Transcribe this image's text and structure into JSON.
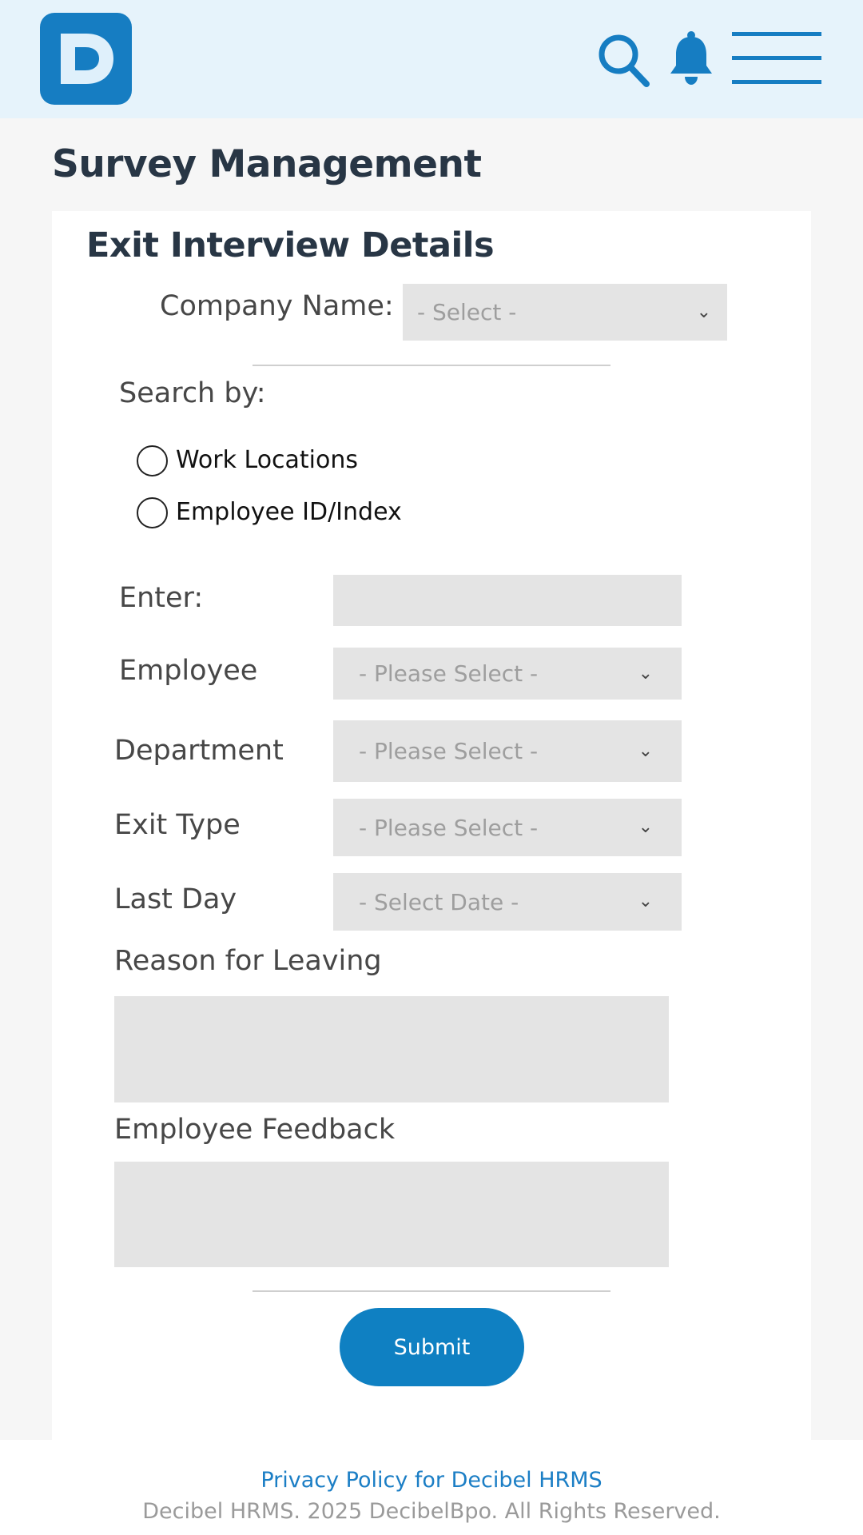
{
  "header": {
    "logo_icon": "decibel-d-logo",
    "search_icon": "search-icon",
    "bell_icon": "bell-icon",
    "menu_icon": "hamburger-menu-icon",
    "accent_color": "#167dc2"
  },
  "page": {
    "title": "Survey Management"
  },
  "card": {
    "title": "Exit Interview Details",
    "company": {
      "label": "Company Name:",
      "value": "- Select -"
    },
    "search_by": {
      "label": "Search by:",
      "options": [
        "Work Locations",
        "Employee ID/Index"
      ]
    },
    "enter": {
      "label": "Enter:",
      "value": ""
    },
    "employee": {
      "label": "Employee",
      "value": "- Please Select -"
    },
    "department": {
      "label": "Department",
      "value": "- Please Select -"
    },
    "exit_type": {
      "label": "Exit Type",
      "value": "- Please Select -"
    },
    "last_day": {
      "label": "Last Day",
      "value": "- Select Date -"
    },
    "reason": {
      "label": "Reason for Leaving",
      "value": ""
    },
    "feedback": {
      "label": "Employee Feedback",
      "value": ""
    },
    "submit_label": "Submit"
  },
  "footer": {
    "privacy": "Privacy Policy for Decibel HRMS",
    "copyright": "Decibel HRMS. 2025 DecibelBpo. All Rights Reserved."
  }
}
